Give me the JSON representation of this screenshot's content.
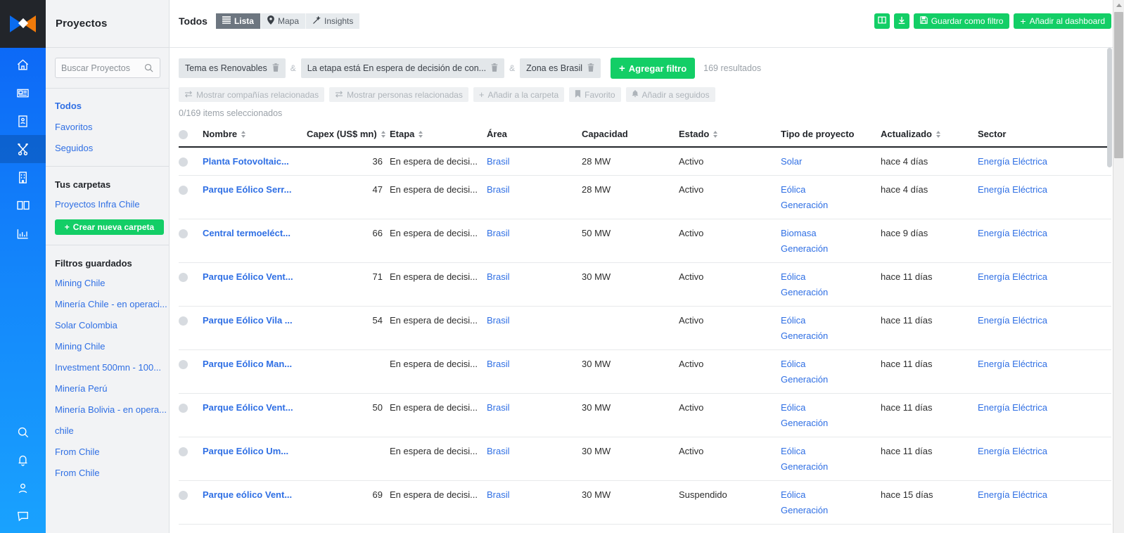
{
  "brand": {
    "logo_name": "bnamericas-logo",
    "accent_green": "#13ce66",
    "accent_blue": "#2f6fe4",
    "rail_blue": "#0b63f6"
  },
  "rail": {
    "items": [
      {
        "icon": "home-icon",
        "name": "home"
      },
      {
        "icon": "news-icon",
        "name": "news"
      },
      {
        "icon": "contact-card-icon",
        "name": "contacts"
      },
      {
        "icon": "projects-icon",
        "name": "projects",
        "active": true
      },
      {
        "icon": "company-building-icon",
        "name": "companies"
      },
      {
        "icon": "book-icon",
        "name": "library"
      },
      {
        "icon": "bar-chart-icon",
        "name": "analytics"
      }
    ],
    "bottom_items": [
      {
        "icon": "search-icon",
        "name": "search"
      },
      {
        "icon": "bell-icon",
        "name": "notifications"
      },
      {
        "icon": "user-icon",
        "name": "account"
      },
      {
        "icon": "chat-icon",
        "name": "support"
      }
    ]
  },
  "sidebar": {
    "title": "Proyectos",
    "search": {
      "placeholder": "Buscar Proyectos",
      "value": "",
      "icon": "search-icon"
    },
    "views": [
      {
        "label": "Todos",
        "active": true
      },
      {
        "label": "Favoritos",
        "active": false
      },
      {
        "label": "Seguidos",
        "active": false
      }
    ],
    "folders_heading": "Tus carpetas",
    "folders": [
      {
        "label": "Proyectos Infra Chile"
      }
    ],
    "new_folder_label": "Crear nueva carpeta",
    "saved_filters_heading": "Filtros guardados",
    "saved_filters": [
      {
        "label": "Mining Chile"
      },
      {
        "label": "Minería Chile - en operaci..."
      },
      {
        "label": "Solar Colombia"
      },
      {
        "label": "Mining Chile"
      },
      {
        "label": "Investment 500mn - 100..."
      },
      {
        "label": "Minería Perú"
      },
      {
        "label": "Minería Bolivia - en opera..."
      },
      {
        "label": "chile"
      },
      {
        "label": "From Chile"
      },
      {
        "label": "From Chile"
      }
    ]
  },
  "topbar": {
    "scope_label": "Todos",
    "tabs": [
      {
        "label": "Lista",
        "icon": "list-icon",
        "active": true
      },
      {
        "label": "Mapa",
        "icon": "map-pin-icon",
        "active": false
      },
      {
        "label": "Insights",
        "icon": "magic-wand-icon",
        "active": false
      }
    ],
    "columns_button": {
      "name": "columns-button",
      "icon": "columns-icon"
    },
    "download_button": {
      "name": "download-button",
      "icon": "download-icon"
    },
    "save_filter_label": "Guardar como filtro",
    "save_filter_icon": "floppy-disk-icon",
    "add_dashboard_label": "Añadir al dashboard",
    "add_dashboard_icon": "plus-icon"
  },
  "filters": {
    "chips": [
      {
        "label": "Tema es Renovables",
        "icon": "trash-icon"
      },
      {
        "label": "La etapa está En espera de decisión de con...",
        "icon": "trash-icon"
      },
      {
        "label": "Zona es Brasil",
        "icon": "trash-icon"
      }
    ],
    "conjunction": "&",
    "add_filter_label": "Agregar filtro",
    "results_label": "169 resultados"
  },
  "actions": {
    "buttons": [
      {
        "label": "Mostrar compañías relacionadas",
        "icon": "exchange-icon"
      },
      {
        "label": "Mostrar personas relacionadas",
        "icon": "exchange-icon"
      },
      {
        "label": "Añadir a la carpeta",
        "icon": "plus-icon"
      },
      {
        "label": "Favorito",
        "icon": "bookmark-icon"
      },
      {
        "label": "Añadir a seguidos",
        "icon": "bell-icon"
      }
    ],
    "selected_label": "0/169 items seleccionados"
  },
  "table": {
    "columns": [
      {
        "label": "Nombre",
        "sortable": true,
        "align": "left"
      },
      {
        "label": "Capex (US$ mn)",
        "sortable": true,
        "align": "right"
      },
      {
        "label": "Etapa",
        "sortable": true,
        "align": "left"
      },
      {
        "label": "Área",
        "sortable": false,
        "align": "left"
      },
      {
        "label": "Capacidad",
        "sortable": false,
        "align": "left"
      },
      {
        "label": "Estado",
        "sortable": true,
        "align": "left"
      },
      {
        "label": "Tipo de proyecto",
        "sortable": false,
        "align": "left"
      },
      {
        "label": "Actualizado",
        "sortable": true,
        "align": "left"
      },
      {
        "label": "Sector",
        "sortable": false,
        "align": "left"
      }
    ],
    "rows": [
      {
        "nombre": "Planta Fotovoltaic...",
        "capex": "36",
        "etapa": "En espera de decisi...",
        "area": "Brasil",
        "capacidad": "28 MW",
        "estado": "Activo",
        "tipo": [
          "Solar"
        ],
        "actualizado": "hace 4 días",
        "sector": "Energía Eléctrica"
      },
      {
        "nombre": "Parque Eólico Serr...",
        "capex": "47",
        "etapa": "En espera de decisi...",
        "area": "Brasil",
        "capacidad": "28 MW",
        "estado": "Activo",
        "tipo": [
          "Eólica",
          "Generación"
        ],
        "actualizado": "hace 4 días",
        "sector": "Energía Eléctrica"
      },
      {
        "nombre": "Central termoeléct...",
        "capex": "66",
        "etapa": "En espera de decisi...",
        "area": "Brasil",
        "capacidad": "50 MW",
        "estado": "Activo",
        "tipo": [
          "Biomasa",
          "Generación"
        ],
        "actualizado": "hace 9 días",
        "sector": "Energía Eléctrica"
      },
      {
        "nombre": "Parque Eólico Vent...",
        "capex": "71",
        "etapa": "En espera de decisi...",
        "area": "Brasil",
        "capacidad": "30 MW",
        "estado": "Activo",
        "tipo": [
          "Eólica",
          "Generación"
        ],
        "actualizado": "hace 11 días",
        "sector": "Energía Eléctrica"
      },
      {
        "nombre": "Parque Eólico Vila ...",
        "capex": "54",
        "etapa": "En espera de decisi...",
        "area": "Brasil",
        "capacidad": "",
        "estado": "Activo",
        "tipo": [
          "Eólica",
          "Generación"
        ],
        "actualizado": "hace 11 días",
        "sector": "Energía Eléctrica"
      },
      {
        "nombre": "Parque Eólico Man...",
        "capex": "",
        "etapa": "En espera de decisi...",
        "area": "Brasil",
        "capacidad": "30 MW",
        "estado": "Activo",
        "tipo": [
          "Eólica",
          "Generación"
        ],
        "actualizado": "hace 11 días",
        "sector": "Energía Eléctrica"
      },
      {
        "nombre": "Parque Eólico Vent...",
        "capex": "50",
        "etapa": "En espera de decisi...",
        "area": "Brasil",
        "capacidad": "30 MW",
        "estado": "Activo",
        "tipo": [
          "Eólica",
          "Generación"
        ],
        "actualizado": "hace 11 días",
        "sector": "Energía Eléctrica"
      },
      {
        "nombre": "Parque Eólico Um...",
        "capex": "",
        "etapa": "En espera de decisi...",
        "area": "Brasil",
        "capacidad": "30 MW",
        "estado": "Activo",
        "tipo": [
          "Eólica",
          "Generación"
        ],
        "actualizado": "hace 11 días",
        "sector": "Energía Eléctrica"
      },
      {
        "nombre": "Parque eólico Vent...",
        "capex": "69",
        "etapa": "En espera de decisi...",
        "area": "Brasil",
        "capacidad": "30 MW",
        "estado": "Suspendido",
        "tipo": [
          "Eólica",
          "Generación"
        ],
        "actualizado": "hace 15 días",
        "sector": "Energía Eléctrica"
      }
    ]
  }
}
